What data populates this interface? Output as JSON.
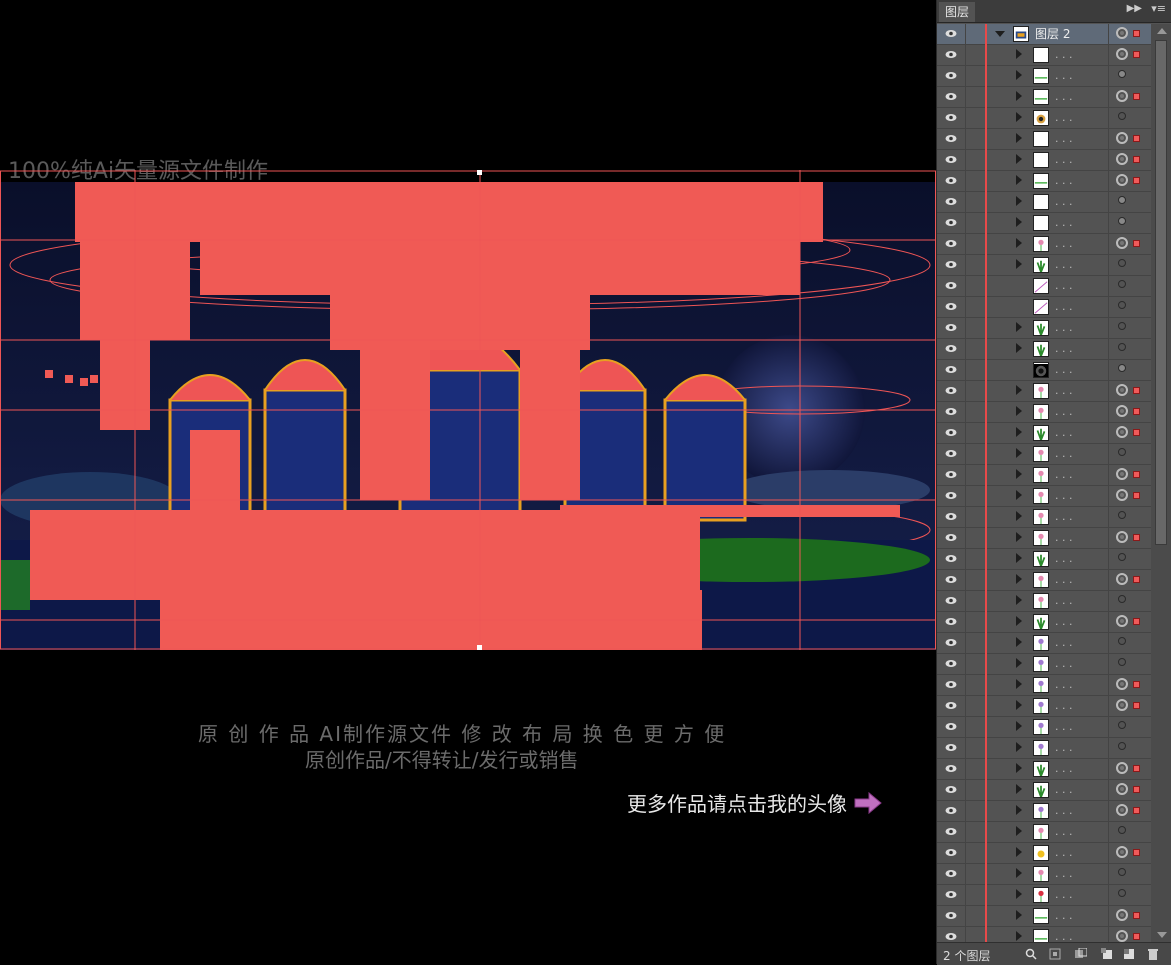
{
  "canvas": {
    "watermark": "100%纯Ai矢量源文件制作",
    "caption_line1": "原 创 作 品   AI制作源文件  修 改 布 局  换 色 更 方 便",
    "caption_line2": "原创作品/不得转让/发行或销售",
    "more_link": "更多作品请点击我的头像"
  },
  "layers_panel": {
    "tab_label": "图层",
    "collapse_icon": "double-chevron-right-icon",
    "menu_icon": "panel-menu-icon",
    "top_layer_name": "图层 2",
    "sublayer_name": ". . .",
    "footer_count": "2 个图层",
    "layer_color": "#e84a4a",
    "sublayers": [
      {
        "thumb": "blank",
        "target": "ring",
        "selected": true,
        "expandable": true
      },
      {
        "thumb": "line-green",
        "target": "filled",
        "selected": false,
        "expandable": true
      },
      {
        "thumb": "line-green",
        "target": "ring",
        "selected": true,
        "expandable": true
      },
      {
        "thumb": "character",
        "target": "empty",
        "selected": false,
        "expandable": true
      },
      {
        "thumb": "blank",
        "target": "ring",
        "selected": true,
        "expandable": true
      },
      {
        "thumb": "blank",
        "target": "ring",
        "selected": true,
        "expandable": true
      },
      {
        "thumb": "line-green",
        "target": "ring",
        "selected": true,
        "expandable": true
      },
      {
        "thumb": "blank",
        "target": "filled",
        "selected": false,
        "expandable": true
      },
      {
        "thumb": "blank",
        "target": "filled",
        "selected": false,
        "expandable": true
      },
      {
        "thumb": "flower-pink",
        "target": "ring",
        "selected": true,
        "expandable": true
      },
      {
        "thumb": "plant-green",
        "target": "empty",
        "selected": false,
        "expandable": true
      },
      {
        "thumb": "line-purple",
        "target": "empty",
        "selected": false,
        "expandable": false
      },
      {
        "thumb": "line-purple",
        "target": "empty",
        "selected": false,
        "expandable": false
      },
      {
        "thumb": "plant-green",
        "target": "empty",
        "selected": false,
        "expandable": true
      },
      {
        "thumb": "plant-green",
        "target": "empty",
        "selected": false,
        "expandable": true
      },
      {
        "thumb": "dark-circle",
        "target": "filled",
        "selected": false,
        "expandable": false
      },
      {
        "thumb": "flower-pink",
        "target": "ring",
        "selected": true,
        "expandable": true
      },
      {
        "thumb": "flower-pink",
        "target": "ring",
        "selected": true,
        "expandable": true
      },
      {
        "thumb": "plant-green",
        "target": "ring",
        "selected": true,
        "expandable": true
      },
      {
        "thumb": "flower-pink",
        "target": "empty",
        "selected": false,
        "expandable": true
      },
      {
        "thumb": "flower-pink",
        "target": "ring",
        "selected": true,
        "expandable": true
      },
      {
        "thumb": "flower-pink",
        "target": "ring",
        "selected": true,
        "expandable": true
      },
      {
        "thumb": "flower-pink",
        "target": "empty",
        "selected": false,
        "expandable": true
      },
      {
        "thumb": "flower-pink",
        "target": "ring",
        "selected": true,
        "expandable": true
      },
      {
        "thumb": "plant-green",
        "target": "empty",
        "selected": false,
        "expandable": true
      },
      {
        "thumb": "flower-pink",
        "target": "ring",
        "selected": true,
        "expandable": true
      },
      {
        "thumb": "flower-pink",
        "target": "empty",
        "selected": false,
        "expandable": true
      },
      {
        "thumb": "plant-green",
        "target": "ring",
        "selected": true,
        "expandable": true
      },
      {
        "thumb": "flower-purple",
        "target": "empty",
        "selected": false,
        "expandable": true
      },
      {
        "thumb": "flower-purple",
        "target": "empty",
        "selected": false,
        "expandable": true
      },
      {
        "thumb": "flower-purple",
        "target": "ring",
        "selected": true,
        "expandable": true
      },
      {
        "thumb": "flower-purple",
        "target": "ring",
        "selected": true,
        "expandable": true
      },
      {
        "thumb": "flower-purple",
        "target": "empty",
        "selected": false,
        "expandable": true
      },
      {
        "thumb": "flower-purple",
        "target": "empty",
        "selected": false,
        "expandable": true
      },
      {
        "thumb": "plant-green",
        "target": "ring",
        "selected": true,
        "expandable": true
      },
      {
        "thumb": "plant-green",
        "target": "ring",
        "selected": true,
        "expandable": true
      },
      {
        "thumb": "flower-purple",
        "target": "ring",
        "selected": true,
        "expandable": true
      },
      {
        "thumb": "flower-pink",
        "target": "empty",
        "selected": false,
        "expandable": true
      },
      {
        "thumb": "flower-yellow",
        "target": "ring",
        "selected": true,
        "expandable": true
      },
      {
        "thumb": "flower-pink",
        "target": "empty",
        "selected": false,
        "expandable": true
      },
      {
        "thumb": "flower-red",
        "target": "empty",
        "selected": false,
        "expandable": true
      },
      {
        "thumb": "line-green",
        "target": "ring",
        "selected": true,
        "expandable": true
      },
      {
        "thumb": "line-green",
        "target": "ring",
        "selected": true,
        "expandable": true
      }
    ],
    "footer_buttons": [
      "search-icon",
      "locate-object-icon",
      "make-clipping-mask-icon",
      "create-sublayer-icon",
      "new-layer-icon",
      "delete-icon"
    ]
  }
}
